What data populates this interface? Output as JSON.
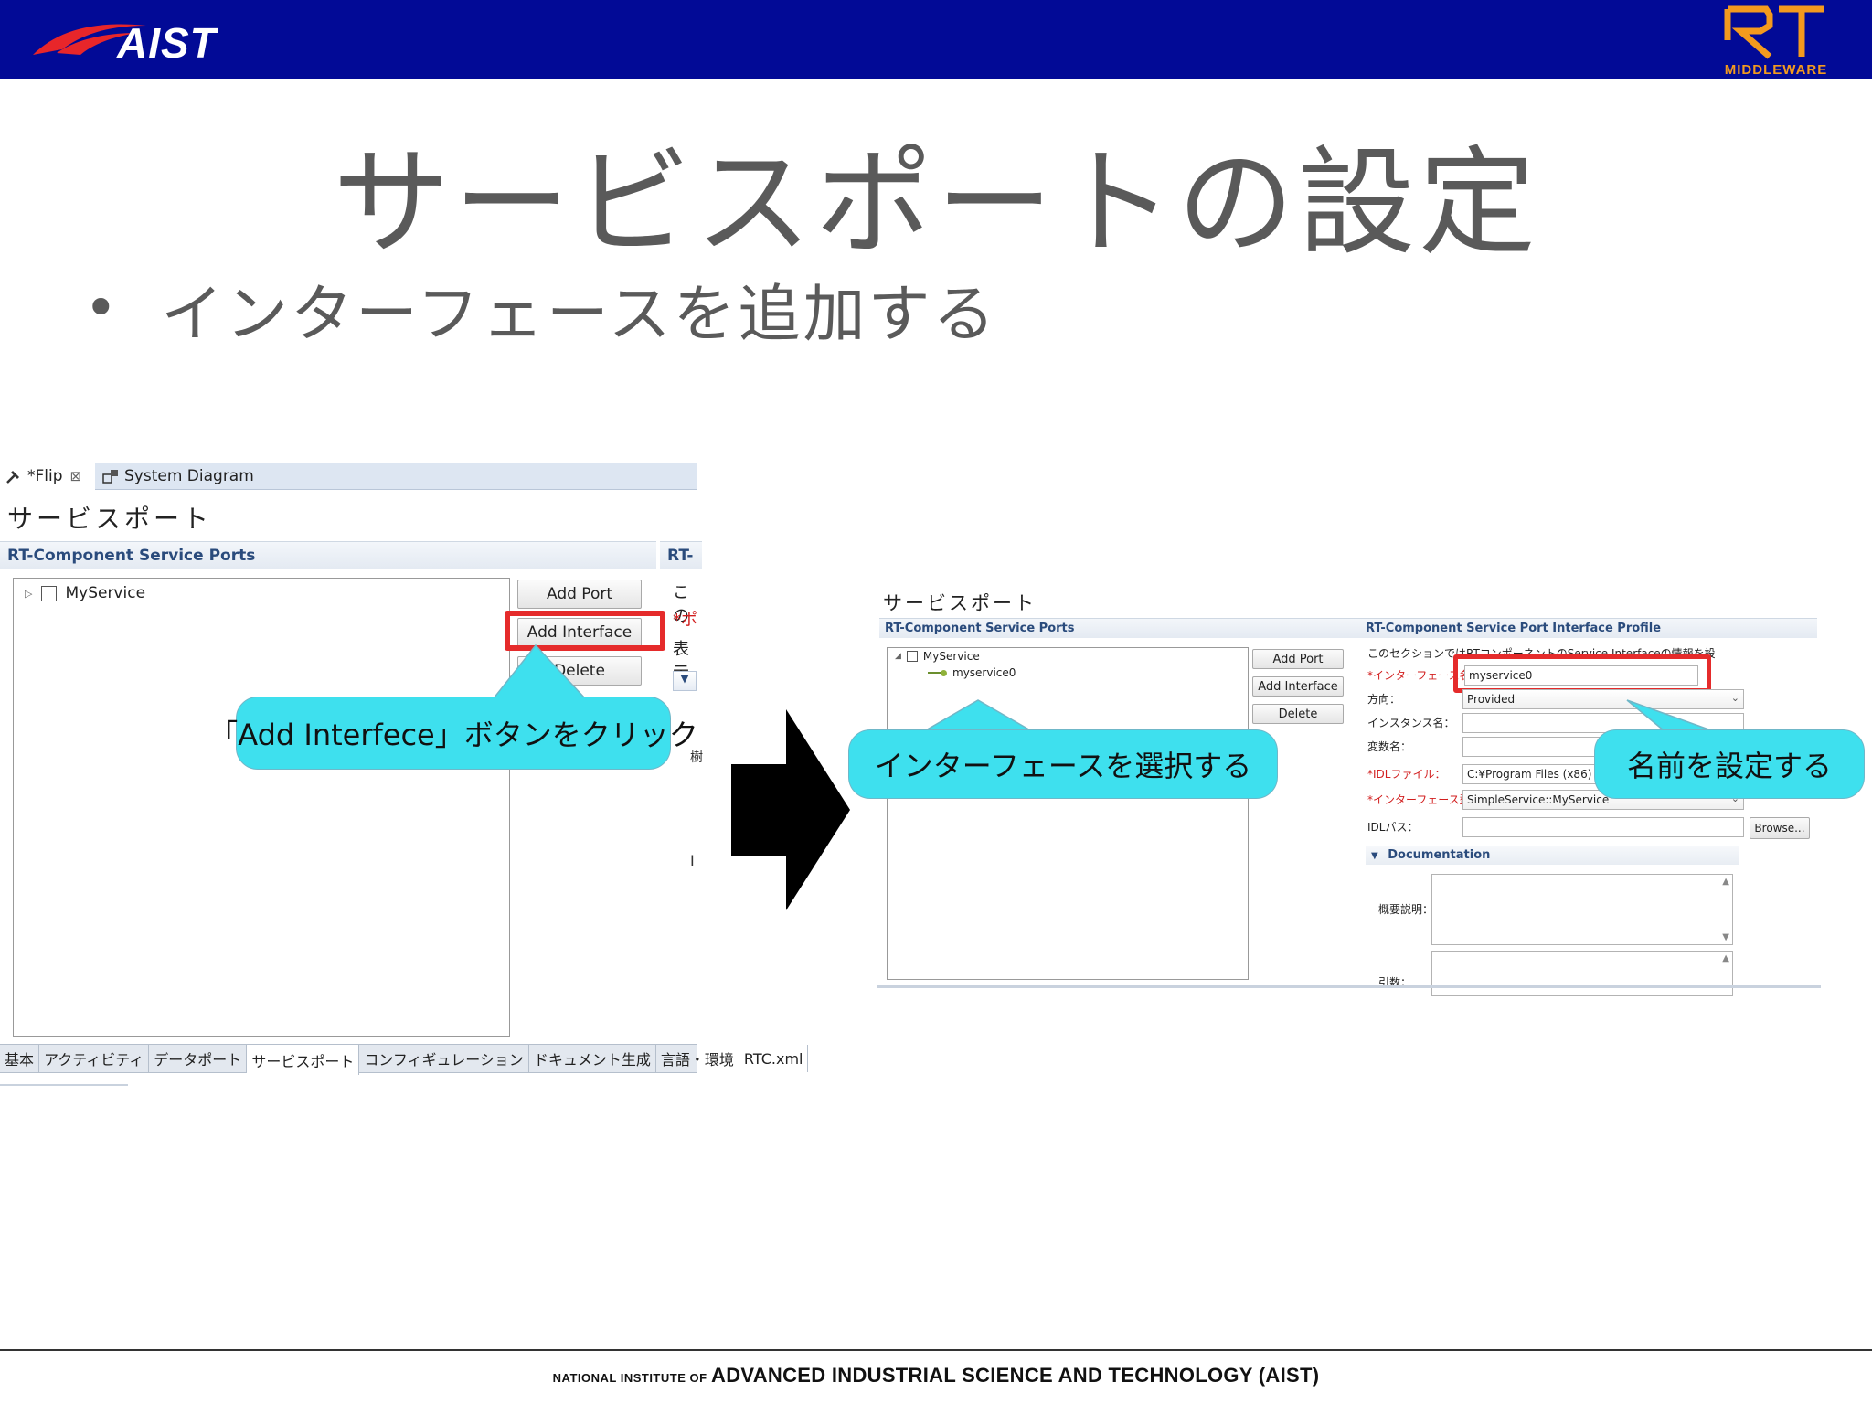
{
  "header": {
    "aist_logo_text": "AIST",
    "rt_logo_mark": "RT",
    "rt_logo_text": "MIDDLEWARE",
    "band_color": "#020a96",
    "rt_color": "#f39a1e"
  },
  "slide": {
    "title": "サービスポートの設定",
    "bullet": "インターフェースを追加する"
  },
  "left_shot": {
    "tabs": [
      {
        "label": "*Flip",
        "icon": "hammer-icon",
        "closable": true
      },
      {
        "label": "System Diagram",
        "icon": "diagram-icon"
      }
    ],
    "section_title": "サービスポート",
    "ports_header": "RT-Component Service Ports",
    "right_header_clip": "RT-",
    "tree_item": "MyService",
    "buttons": {
      "add_port": "Add Port",
      "add_interface": "Add Interface",
      "delete": "Delete"
    },
    "right_clip_lines": [
      "この",
      "*ポ",
      "表示",
      "",
      "",
      "樹",
      "",
      "I"
    ],
    "bottom_tabs": [
      "基本",
      "アクティビティ",
      "データポート",
      "サービスポート",
      "コンフィギュレーション",
      "ドキュメント生成",
      "言語・環境",
      "RTC.xml"
    ],
    "active_bottom_tab": 3,
    "callout": "「Add Interfece」ボタンをクリック"
  },
  "right_shot": {
    "section_title": "サービスポート",
    "ports_header": "RT-Component Service Ports",
    "profile_header": "RT-Component Service Port Interface Profile",
    "tree_parent": "MyService",
    "tree_child": "myservice0",
    "buttons": {
      "add_port": "Add Port",
      "add_interface": "Add Interface",
      "delete": "Delete",
      "browse": "Browse..."
    },
    "description": "このセクションではRTコンポーネントのService Interfaceの情報を設定します。",
    "fields": {
      "interface_name_label": "*インターフェース名：",
      "interface_name_value": "myservice0",
      "direction_label": "方向：",
      "direction_value": "Provided",
      "instance_label": "インスタンス名：",
      "variable_label": "変数名：",
      "idl_file_label": "*IDLファイル：",
      "idl_file_value": "C:¥Program Files (x86)",
      "interface_type_label": "*インターフェース型：",
      "interface_type_value": "SimpleService::MyService",
      "idl_path_label": "IDLパス："
    },
    "documentation_label": "Documentation",
    "summary_label": "概要説明：",
    "args_label": "引数：",
    "callout_select": "インターフェースを選択する",
    "callout_name": "名前を設定する"
  },
  "footer": {
    "prefix": "NATIONAL INSTITUTE OF",
    "main": "ADVANCED INDUSTRIAL SCIENCE AND TECHNOLOGY (AIST)"
  },
  "colors": {
    "callout": "#3ee0ee",
    "highlight": "#e52b2b",
    "title_text": "#5a5a5a"
  }
}
